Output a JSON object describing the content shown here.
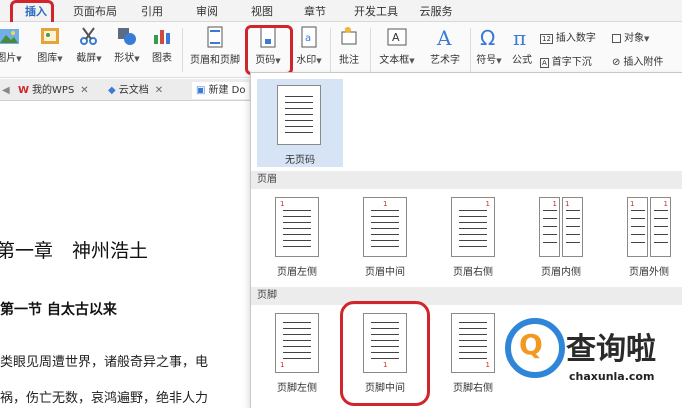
{
  "tabs": [
    "插入",
    "页面布局",
    "引用",
    "审阅",
    "视图",
    "章节",
    "开发工具",
    "云服务"
  ],
  "ribbon": {
    "picture": "图片",
    "gallery": "图库",
    "screenshot": "截屏",
    "shapes": "形状",
    "chart": "图表",
    "header_footer": "页眉和页脚",
    "page_number": "页码",
    "watermark": "水印",
    "comment": "批注",
    "textbox": "文本框",
    "wordart": "艺术字",
    "symbol": "符号",
    "formula": "公式",
    "insert_number": "插入数字",
    "object": "对象",
    "dropcap": "首字下沉",
    "attachment": "插入附件"
  },
  "doc_tabs": {
    "wps": "我的WPS",
    "cloud": "云文档",
    "new": "新建 Do"
  },
  "document": {
    "chapter": "第一章　神州浩土",
    "section": "第一节  自太古以来",
    "para1": "类眼见周遭世界，诸般奇异之事，电",
    "para2": "祸，伤亡无数，哀鸿遍野，绝非人力"
  },
  "dropdown": {
    "no_page_number": "无页码",
    "header_section": "页眉",
    "footer_section": "页脚",
    "header_options": [
      "页眉左侧",
      "页眉中间",
      "页眉右侧",
      "页眉内侧",
      "页眉外侧"
    ],
    "footer_options": [
      "页脚左侧",
      "页脚中间",
      "页脚右侧"
    ],
    "page_num": "1"
  },
  "watermark": {
    "brand": "查询啦",
    "url": "chaxunla.com"
  },
  "colors": {
    "highlight": "#d0262b",
    "selected_tile": "#d6e4f6",
    "accent": "#2a6cc0"
  }
}
